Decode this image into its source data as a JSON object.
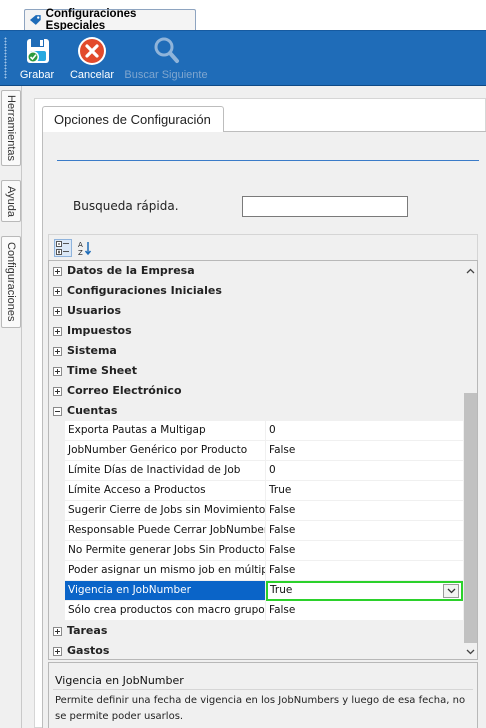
{
  "window": {
    "tab_title": "Configuraciones Especiales"
  },
  "ribbon": {
    "save_label": "Grabar",
    "cancel_label": "Cancelar",
    "find_next_label": "Buscar Siguiente"
  },
  "sidebar": {
    "tabs": [
      {
        "label": "Herramientas"
      },
      {
        "label": "Ayuda"
      },
      {
        "label": "Configuraciones"
      }
    ]
  },
  "panel": {
    "tab_label": "Opciones de Configuración",
    "search_label": "Busqueda rápida.",
    "search_value": ""
  },
  "grid": {
    "categories_before": [
      "Datos de la Empresa",
      "Configuraciones Iniciales",
      "Usuarios",
      "Impuestos",
      "Sistema",
      "Time Sheet",
      "Correo Electrónico"
    ],
    "expanded_category": "Cuentas",
    "properties": [
      {
        "name": "Exporta Pautas a Multigap",
        "value": "0"
      },
      {
        "name": "JobNumber Genérico por Producto",
        "value": "False"
      },
      {
        "name": "Límite Días de Inactividad de Job",
        "value": "0"
      },
      {
        "name": "Límite Acceso a Productos",
        "value": "True"
      },
      {
        "name": "Sugerir Cierre de Jobs sin Movimientos",
        "value": "False"
      },
      {
        "name": "Responsable Puede Cerrar JobNumber",
        "value": "False"
      },
      {
        "name": "No Permite generar Jobs Sin Producto",
        "value": "False"
      },
      {
        "name": "Poder asignar un mismo job en múltiples",
        "value": "False"
      },
      {
        "name": "Vigencia en JobNumber",
        "value": "True"
      },
      {
        "name": "Sólo crea productos con macro grupo y",
        "value": "False"
      }
    ],
    "selected_index": 8,
    "categories_after": [
      "Tareas",
      "Gastos"
    ]
  },
  "description": {
    "title": "Vigencia en JobNumber",
    "text": "Permite definir una fecha de vigencia en los JobNumbers y luego de esa fecha, no se permite poder usarlos."
  },
  "colors": {
    "ribbon": "#1f6cb8",
    "selection": "#0a64c8",
    "highlight_border": "#2bd12b"
  }
}
